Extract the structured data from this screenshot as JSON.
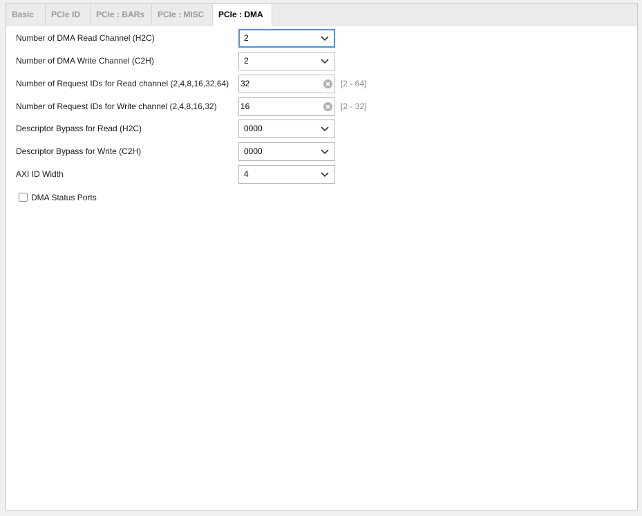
{
  "tabs": [
    {
      "label": "Basic"
    },
    {
      "label": "PCIe ID"
    },
    {
      "label": "PCIe : BARs"
    },
    {
      "label": "PCIe : MISC"
    },
    {
      "label": "PCIe : DMA"
    }
  ],
  "active_tab": "PCIe : DMA",
  "fields": [
    {
      "label": "Number of DMA Read Channel (H2C)",
      "type": "combo",
      "value": "2",
      "focused": true
    },
    {
      "label": "Number of DMA Write Channel (C2H)",
      "type": "combo",
      "value": "2"
    },
    {
      "label": "Number of Request IDs for Read channel (2,4,8,16,32,64)",
      "type": "text",
      "value": "32",
      "range": "[2 - 64]"
    },
    {
      "label": "Number of Request IDs for Write channel (2,4,8,16,32)",
      "type": "text",
      "value": "16",
      "range": "[2 - 32]"
    },
    {
      "label": "Descriptor Bypass for Read (H2C)",
      "type": "combo",
      "value": "0000"
    },
    {
      "label": "Descriptor Bypass for Write (C2H)",
      "type": "combo",
      "value": "0000"
    },
    {
      "label": "AXI ID Width",
      "type": "combo",
      "value": "4"
    }
  ],
  "dma_status_ports": {
    "label": "DMA Status Ports",
    "checked": false
  },
  "icons": {
    "dropdown": "chevron-down-icon",
    "clear": "clear-circle-icon"
  },
  "colors": {
    "focus_border": "#5d8fc9",
    "active_tab_text": "#000000",
    "inactive_tab_text": "#9a9a9a",
    "range_hint": "#8a8a8a"
  }
}
